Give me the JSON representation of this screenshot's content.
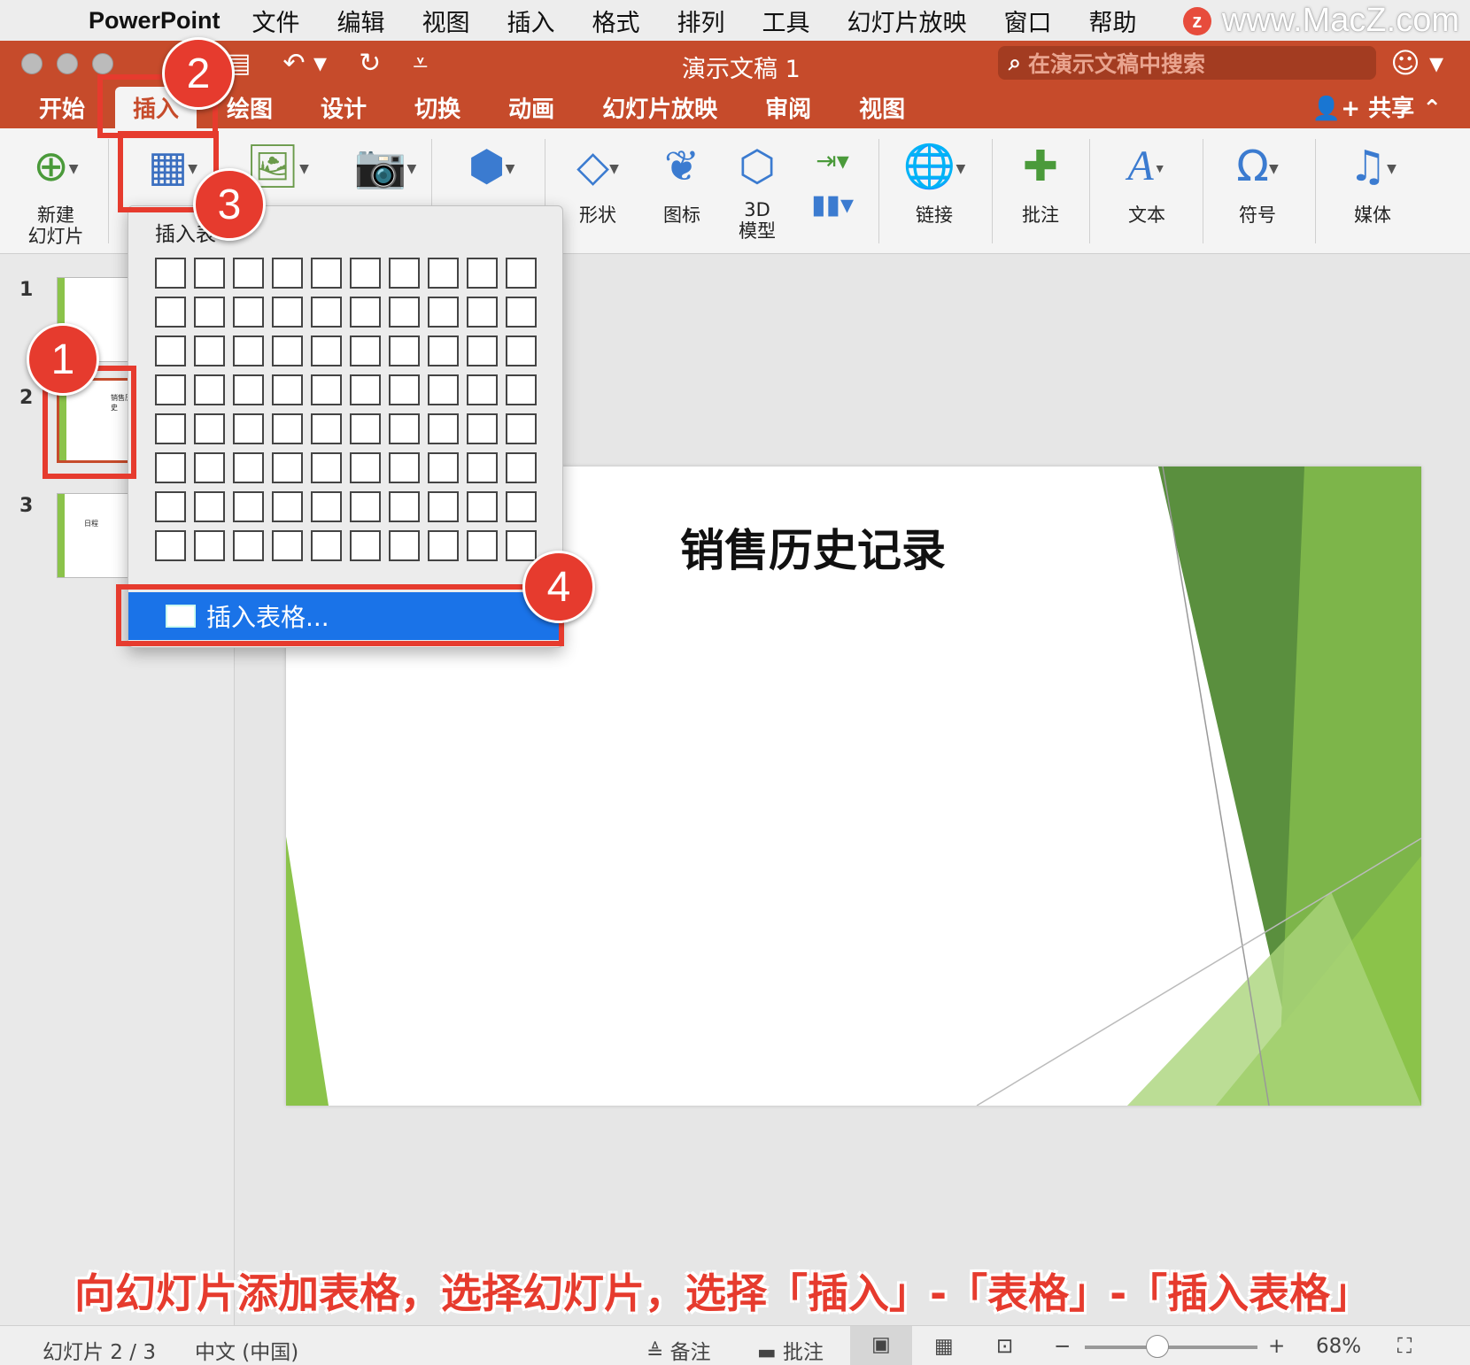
{
  "menubar": {
    "apple": "",
    "app": "PowerPoint",
    "items": [
      "文件",
      "编辑",
      "视图",
      "插入",
      "格式",
      "排列",
      "工具",
      "幻灯片放映",
      "窗口",
      "帮助"
    ],
    "watermark": "www.MacZ.com",
    "watermark_logo": "z"
  },
  "window": {
    "title": "演示文稿 1",
    "search_placeholder": "在演示文稿中搜索",
    "share": "共享"
  },
  "tabs": [
    "开始",
    "插入",
    "绘图",
    "设计",
    "切换",
    "动画",
    "幻灯片放映",
    "审阅",
    "视图"
  ],
  "active_tab": "插入",
  "ribbon": {
    "new_slide": "新建\n幻灯片",
    "table_label": "插入表",
    "shapes": "形状",
    "icons": "图标",
    "model3d": "3D\n模型",
    "link": "链接",
    "comment": "批注",
    "text": "文本",
    "symbol": "符号",
    "media": "媒体"
  },
  "slides": [
    {
      "num": "1",
      "thumb_text": ""
    },
    {
      "num": "2",
      "thumb_text": "销售历史"
    },
    {
      "num": "3",
      "thumb_text": "日程"
    }
  ],
  "slide": {
    "title": "销售历史记录"
  },
  "dropdown": {
    "label": "插入表",
    "insert_table": "插入表格...",
    "grid_rows": 8,
    "grid_cols": 10
  },
  "badges": [
    "1",
    "2",
    "3",
    "4"
  ],
  "caption": "向幻灯片添加表格，选择幻灯片，选择「插入」-「表格」-「插入表格」",
  "statusbar": {
    "slide_pos": "幻灯片 2 / 3",
    "language": "中文 (中国)",
    "notes": "备注",
    "comments": "批注",
    "zoom": "68%",
    "zoom_fraction": 0.42
  },
  "colors": {
    "accent": "#c64b2b",
    "highlight": "#e63b2e",
    "selection": "#1a73e8",
    "slide_green": "#8bc34a"
  }
}
